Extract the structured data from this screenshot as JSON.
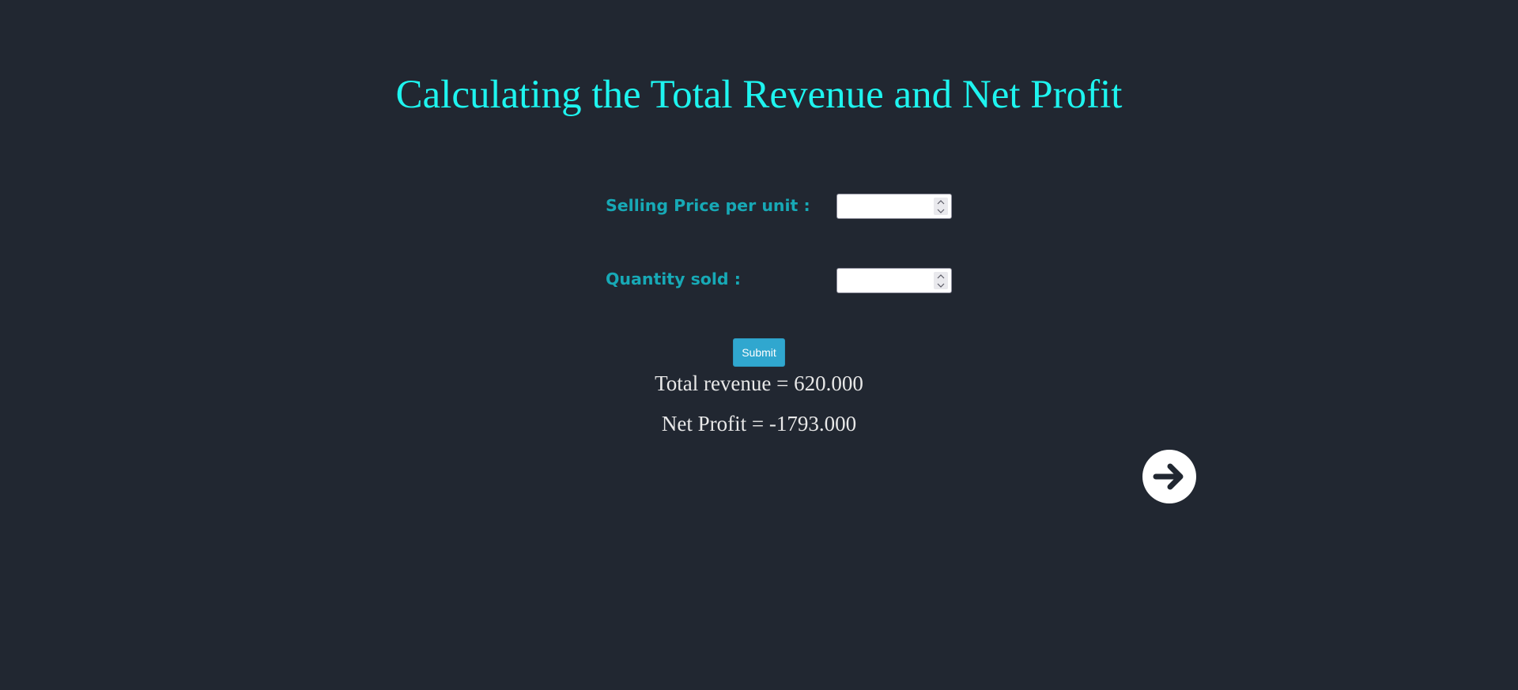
{
  "page": {
    "title": "Calculating the Total Revenue and Net Profit"
  },
  "form": {
    "price_label": "Selling Price per unit :",
    "price_value": "",
    "quantity_label": "Quantity sold :",
    "quantity_value": "",
    "submit_label": "Submit"
  },
  "results": {
    "revenue_text": "Total revenue = 620.000",
    "profit_text": "Net Profit = -1793.000"
  },
  "icons": {
    "next": "arrow-right-circle-icon",
    "spinner": "chevron-up-down-icon"
  },
  "colors": {
    "background": "#212731",
    "title": "#1ef4ef",
    "label": "#17a9b6",
    "button": "#30a7cf",
    "result_text": "#e8e8e8"
  }
}
